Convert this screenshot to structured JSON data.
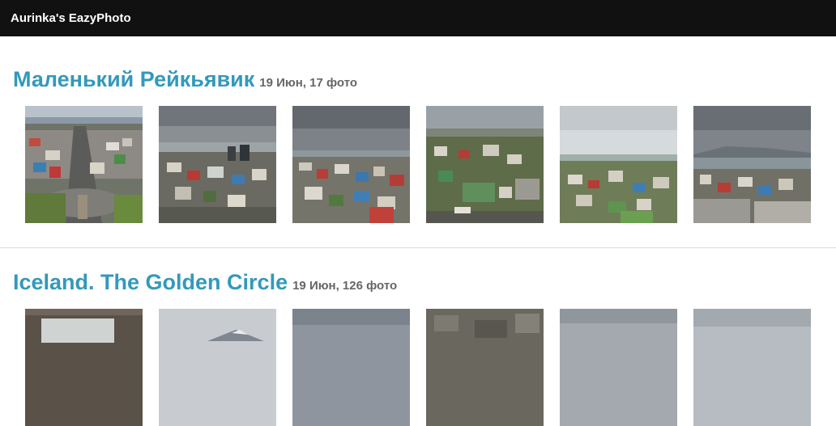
{
  "header": {
    "site_title": "Aurinka's EazyPhoto"
  },
  "albums": [
    {
      "title": "Маленький Рейкьявик",
      "meta": "19 Июн, 17 фото",
      "photos": [
        {
          "name": "photo-1"
        },
        {
          "name": "photo-2"
        },
        {
          "name": "photo-3"
        },
        {
          "name": "photo-4"
        },
        {
          "name": "photo-5"
        },
        {
          "name": "photo-6"
        }
      ]
    },
    {
      "title": "Iceland. The Golden Circle",
      "meta": "19 Июн, 126 фото",
      "photos": [
        {
          "name": "photo-1"
        },
        {
          "name": "photo-2"
        },
        {
          "name": "photo-3"
        },
        {
          "name": "photo-4"
        },
        {
          "name": "photo-5"
        },
        {
          "name": "photo-6"
        }
      ]
    }
  ],
  "colors": {
    "header_bg": "#111111",
    "title_accent": "#3399bb",
    "meta_text": "#666666"
  }
}
